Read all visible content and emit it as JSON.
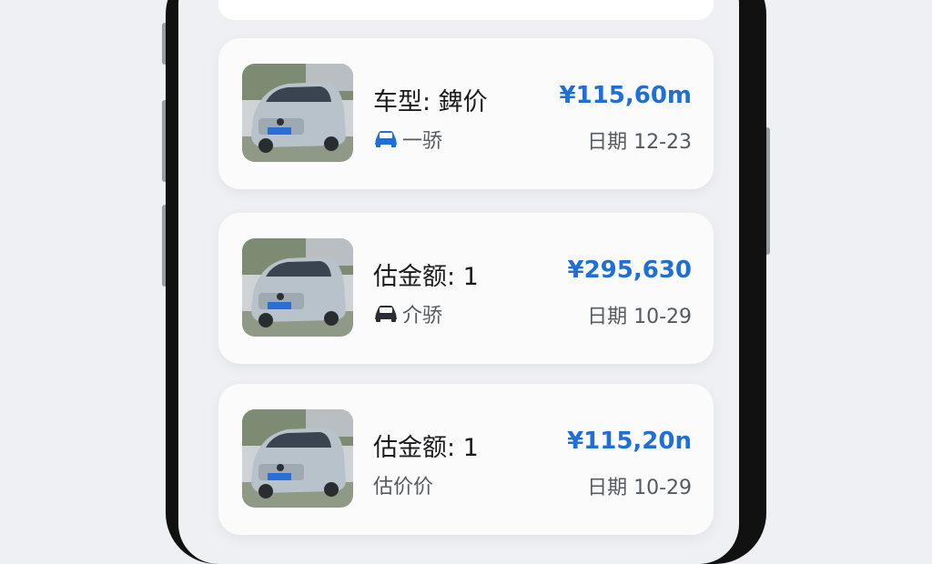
{
  "cards": [
    {
      "title": "车型: 錍价",
      "subtitle": "一骄",
      "subtitle_icon": "car-icon",
      "subtitle_icon_color": "#1f6fd8",
      "price": "¥115,60m",
      "date": "日期 12-23"
    },
    {
      "title": "估金额: 1",
      "subtitle": "介骄",
      "subtitle_icon": "car-icon",
      "subtitle_icon_color": "#2a2d33",
      "price": "¥295,630",
      "date": "日期 10-29"
    },
    {
      "title": "估金额: 1",
      "subtitle": "估价价",
      "price": "¥115,20n",
      "date": "日期 10-29"
    }
  ],
  "colors": {
    "accent": "#1f6fd8",
    "card_bg": "#fbfbfb",
    "page_bg": "#eef0f4"
  }
}
